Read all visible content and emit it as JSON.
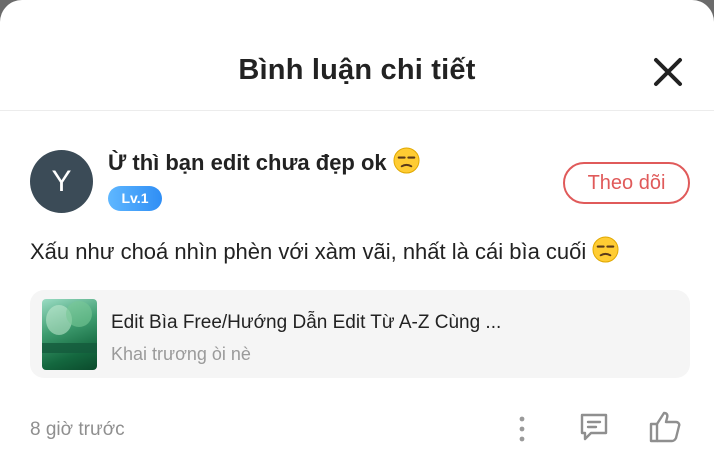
{
  "modal": {
    "title": "Bình luận chi tiết"
  },
  "comment": {
    "avatar_letter": "Y",
    "username": "Ừ thì bạn edit chưa đẹp ok",
    "level_badge": "Lv.1",
    "follow_label": "Theo dõi",
    "body": "Xấu như choá nhìn phèn với xàm vãi, nhất là cái bìa cuối",
    "emoji": "unamused-face",
    "time_ago": "8 giờ trước"
  },
  "linked_post": {
    "title": "Edit Bìa Free/Hướng Dẫn Edit Từ A-Z Cùng ...",
    "subtitle": "Khai trương òi nè"
  },
  "icons": [
    "close-icon",
    "more-vertical-icon",
    "reply-icon",
    "like-icon"
  ],
  "colors": {
    "accent": "#e05a5a",
    "badge": "#2f8ef5",
    "avatar": "#3b4b57"
  }
}
